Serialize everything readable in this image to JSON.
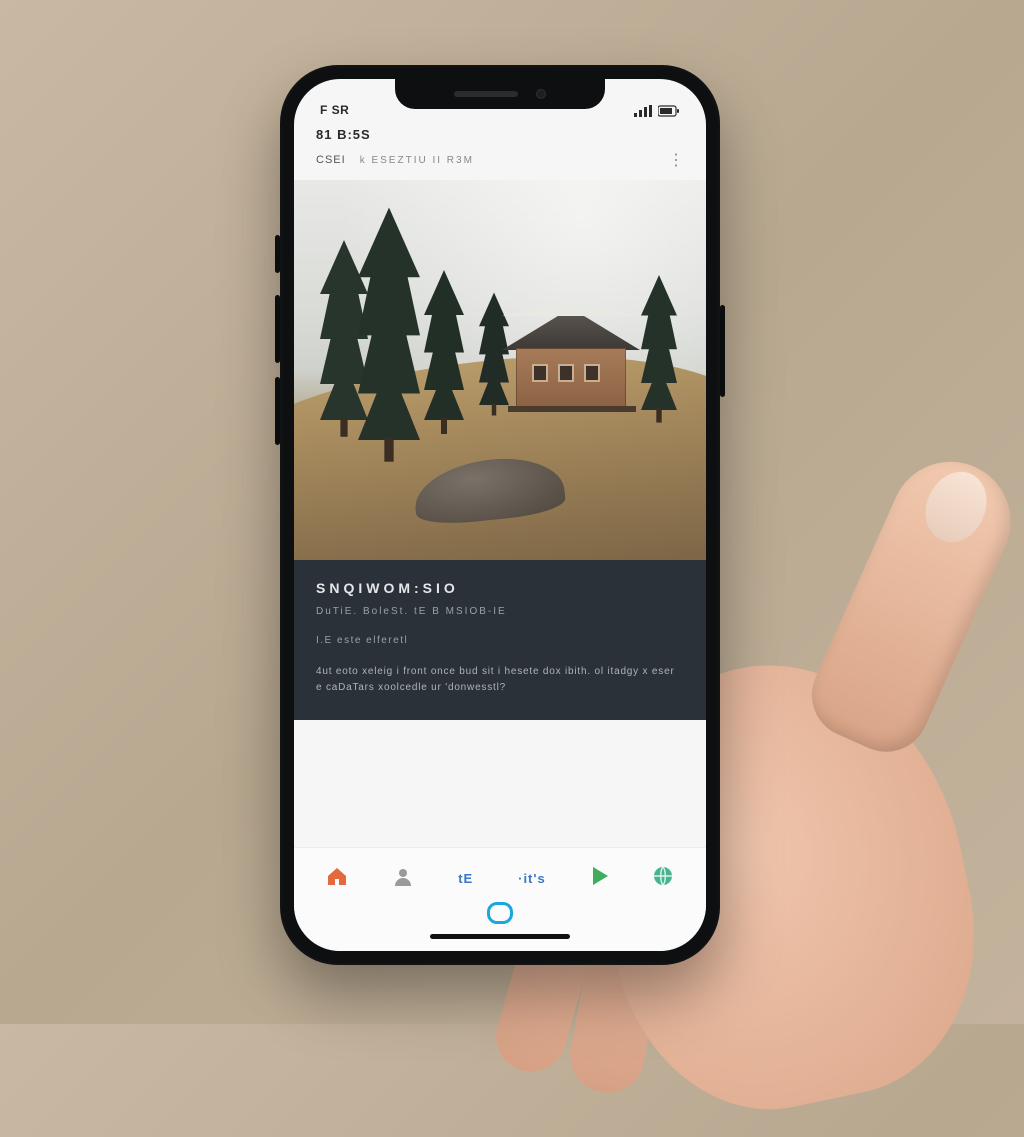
{
  "status": {
    "left": "F SR",
    "right_glyph": "▮▮"
  },
  "header": {
    "time": "81 B:5S",
    "label": "CSEI",
    "subtitle": "k  ESEZTIU II R3M",
    "more_icon_name": "more-icon"
  },
  "panel": {
    "title": "SNQIWOM:SIO",
    "subtitle": "DuTiE. BoleSt. tE B MSIOB-IE",
    "meta": "I.E este elferetl",
    "body": "4ut eoto xeleig i front once bud sit i hesete dox ibith. ol itadgy x eser e caDaTars xoolcedle ur 'donwesstl?"
  },
  "nav": {
    "items": [
      {
        "key": "home",
        "icon": "home-icon",
        "label": ""
      },
      {
        "key": "user",
        "icon": "user-icon",
        "label": ""
      },
      {
        "key": "feed",
        "icon": "feed-icon",
        "label": "tE"
      },
      {
        "key": "stats",
        "icon": "stats-icon",
        "label": "·it's"
      },
      {
        "key": "play",
        "icon": "play-icon",
        "label": ""
      },
      {
        "key": "globe",
        "icon": "globe-icon",
        "label": ""
      }
    ],
    "center_icon": "message-icon"
  },
  "colors": {
    "panel_bg": "#2a3138",
    "accent_orange": "#e36a3d",
    "accent_blue": "#3a77c8",
    "accent_green": "#3fae5b",
    "accent_teal": "#46b48f",
    "accent_cyan": "#19a7e0"
  }
}
